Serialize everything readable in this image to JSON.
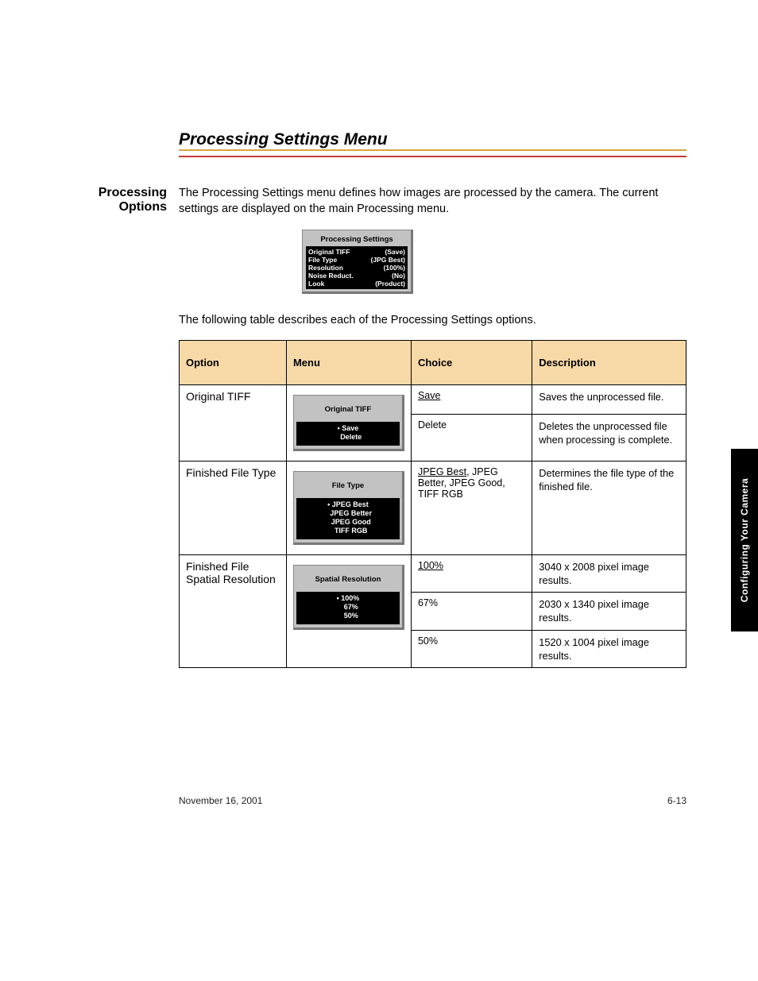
{
  "header": {
    "title": "Processing Settings Menu"
  },
  "intro_label": "Processing Options",
  "intro_text": "The Processing Settings menu defines how images are processed by the camera. The current settings are displayed on the main Processing menu.",
  "settings_panel": {
    "title": "Processing Settings",
    "rows": [
      {
        "k": "Original TIFF",
        "v": "(Save)"
      },
      {
        "k": "File Type",
        "v": "(JPG Best)"
      },
      {
        "k": "Resolution",
        "v": "(100%)"
      },
      {
        "k": "Noise Reduct.",
        "v": "(No)"
      },
      {
        "k": "Look",
        "v": "(Product)"
      }
    ]
  },
  "lead_para": "The following table describes each of the Processing Settings options.",
  "table": {
    "headers": [
      "Option",
      "Menu",
      "Choice",
      "Description"
    ],
    "rows": [
      {
        "option": "Original TIFF",
        "menu": {
          "title": "Original TIFF",
          "items": [
            {
              "label": "Save",
              "selected": true
            },
            {
              "label": "Delete",
              "selected": false
            }
          ]
        },
        "sub": [
          {
            "choice": "Save",
            "underline": true,
            "desc": "Saves the unprocessed file."
          },
          {
            "choice": "Delete",
            "underline": false,
            "desc": "Deletes the unprocessed file when processing is complete."
          }
        ]
      },
      {
        "option": "Finished File Type",
        "menu": {
          "title": "File Type",
          "items": [
            {
              "label": "JPEG Best",
              "selected": true
            },
            {
              "label": "JPEG Better",
              "selected": false
            },
            {
              "label": "JPEG Good",
              "selected": false
            },
            {
              "label": "TIFF RGB",
              "selected": false
            }
          ]
        },
        "sub": [
          {
            "choice": "JPEG Best, JPEG Better, JPEG Good, TIFF RGB",
            "underline_part": "JPEG Best",
            "desc": "Determines the file type of the finished file."
          }
        ]
      },
      {
        "option": "Finished File Spatial Resolution",
        "menu": {
          "title": "Spatial Resolution",
          "items": [
            {
              "label": "100%",
              "selected": true
            },
            {
              "label": "67%",
              "selected": false
            },
            {
              "label": "50%",
              "selected": false
            }
          ]
        },
        "sub": [
          {
            "choice": "100%",
            "underline": true,
            "desc": "3040 x 2008 pixel image results."
          },
          {
            "choice": "67%",
            "underline": false,
            "desc": "2030 x 1340 pixel image results."
          },
          {
            "choice": "50%",
            "underline": false,
            "desc": "1520 x 1004 pixel image results."
          }
        ]
      }
    ]
  },
  "side_tab": "Configuring Your Camera",
  "footer": {
    "date": "November 16, 2001",
    "page": "6-13"
  }
}
